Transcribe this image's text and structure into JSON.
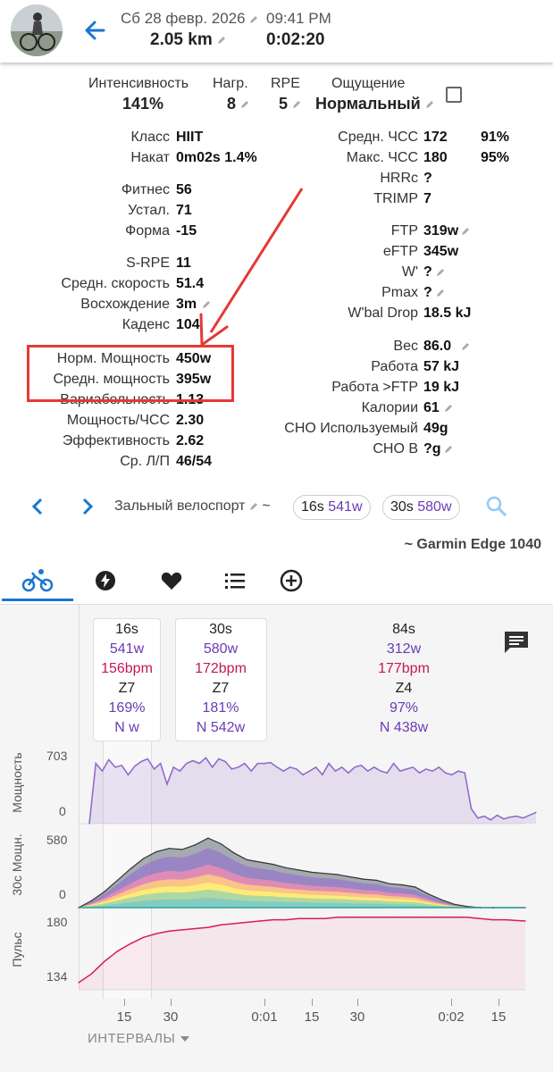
{
  "header": {
    "date": "Сб 28 февр. 2026",
    "time": "09:41 PM",
    "distance": "2.05 km",
    "duration": "0:02:20"
  },
  "summary": {
    "intensity_label": "Интенсивность",
    "intensity_value": "141%",
    "load_label": "Нагр.",
    "load_value": "8",
    "rpe_label": "RPE",
    "rpe_value": "5",
    "feel_label": "Ощущение",
    "feel_value": "Нормальный"
  },
  "left_stats": [
    {
      "label": "Класс",
      "value": "HIIT"
    },
    {
      "label": "Накат",
      "value": "0m02s 1.4%"
    },
    {
      "label": "Фитнес",
      "value": "56"
    },
    {
      "label": "Устал.",
      "value": "71"
    },
    {
      "label": "Форма",
      "value": "-15"
    },
    {
      "label": "S-RPE",
      "value": "11"
    },
    {
      "label": "Средн. скорость",
      "value": "51.4"
    },
    {
      "label": "Восхождение",
      "value": "3m"
    },
    {
      "label": "Каденс",
      "value": "104"
    },
    {
      "label": "Норм. Мощность",
      "value": "450w"
    },
    {
      "label": "Средн. мощность",
      "value": "395w"
    },
    {
      "label": "Вариабельность",
      "value": "1.13"
    },
    {
      "label": "Мощность/ЧСС",
      "value": "2.30"
    },
    {
      "label": "Эффективность",
      "value": "2.62"
    },
    {
      "label": "Ср. Л/П",
      "value": "46/54"
    }
  ],
  "right_stats": [
    {
      "label": "Средн. ЧСС",
      "value": "172",
      "extra": "91%"
    },
    {
      "label": "Макс. ЧСС",
      "value": "180",
      "extra": "95%"
    },
    {
      "label": "HRRc",
      "value": "?"
    },
    {
      "label": "TRIMP",
      "value": "7"
    },
    {
      "label": "FTP",
      "value": "319w"
    },
    {
      "label": "eFTP",
      "value": "345w"
    },
    {
      "label": "W'",
      "value": "?"
    },
    {
      "label": "Pmax",
      "value": "?"
    },
    {
      "label": "W'bal Drop",
      "value": "18.5 kJ"
    },
    {
      "label": "Вес",
      "value": "86.0"
    },
    {
      "label": "Работа",
      "value": "57 kJ"
    },
    {
      "label": "Работа >FTP",
      "value": "19 kJ"
    },
    {
      "label": "Калории",
      "value": "61"
    },
    {
      "label": "CHO Используемый",
      "value": "49g"
    },
    {
      "label": "CHO В",
      "value": "?g"
    }
  ],
  "activity": {
    "type": "Зальный велоспорт",
    "tilde": "~",
    "pill1_dur": "16s",
    "pill1_power": "541w",
    "pill2_dur": "30s",
    "pill2_power": "580w",
    "device": "~ Garmin Edge 1040"
  },
  "intervals": [
    {
      "dur": "16s",
      "power": "541w",
      "hr": "156bpm",
      "zone": "Z7",
      "pct": "169%",
      "np": "N w"
    },
    {
      "dur": "30s",
      "power": "580w",
      "hr": "172bpm",
      "zone": "Z7",
      "pct": "181%",
      "np": "N 542w"
    },
    {
      "dur": "84s",
      "power": "312w",
      "hr": "177bpm",
      "zone": "Z4",
      "pct": "97%",
      "np": "N 438w"
    }
  ],
  "chart_data": [
    {
      "type": "line",
      "ylabel": "Мощность",
      "y_ticks": [
        "703",
        "0"
      ],
      "x": [
        0,
        2,
        4,
        6,
        8,
        10,
        12,
        14,
        16,
        18,
        20,
        22,
        24,
        26,
        28,
        30,
        32,
        34,
        36,
        38,
        40,
        42,
        44,
        46,
        48,
        50,
        52,
        54,
        56,
        58,
        60,
        62,
        64,
        66,
        68,
        70,
        72,
        74,
        76,
        78,
        80,
        82,
        84,
        86,
        88,
        90,
        92,
        94,
        96,
        98,
        100,
        102,
        104,
        106,
        108,
        110,
        112,
        114,
        116,
        118,
        120,
        122,
        124,
        126,
        128,
        130,
        132,
        134,
        136,
        138
      ],
      "values": [
        0,
        640,
        560,
        680,
        600,
        620,
        520,
        610,
        660,
        690,
        580,
        640,
        420,
        600,
        560,
        640,
        670,
        640,
        700,
        600,
        690,
        660,
        580,
        600,
        640,
        560,
        640,
        640,
        650,
        600,
        560,
        600,
        580,
        520,
        560,
        600,
        520,
        640,
        560,
        600,
        540,
        600,
        620,
        560,
        600,
        560,
        540,
        640,
        560,
        580,
        600,
        540,
        580,
        560,
        600,
        540,
        520,
        560,
        540,
        160,
        60,
        80,
        40,
        90,
        50,
        70,
        80,
        60,
        90,
        120
      ]
    },
    {
      "type": "area",
      "ylabel": "30с Мощн.",
      "y_ticks": [
        "580",
        "0"
      ],
      "x": [
        0,
        4,
        8,
        12,
        16,
        20,
        24,
        28,
        32,
        36,
        40,
        44,
        48,
        52,
        56,
        60,
        64,
        68,
        72,
        76,
        80,
        84,
        88,
        92,
        96,
        100,
        104,
        108,
        112,
        116,
        120,
        124,
        128,
        138
      ],
      "values": [
        0,
        60,
        140,
        240,
        340,
        430,
        490,
        520,
        510,
        550,
        610,
        560,
        480,
        420,
        400,
        380,
        350,
        330,
        310,
        300,
        290,
        270,
        250,
        240,
        210,
        200,
        180,
        120,
        70,
        30,
        10,
        0,
        0,
        0
      ]
    },
    {
      "type": "line",
      "ylabel": "Пульс",
      "y_ticks": [
        "180",
        "134"
      ],
      "x": [
        0,
        4,
        8,
        12,
        16,
        20,
        24,
        28,
        32,
        36,
        40,
        44,
        48,
        52,
        56,
        60,
        64,
        68,
        72,
        76,
        80,
        84,
        88,
        92,
        96,
        100,
        104,
        108,
        112,
        116,
        120,
        124,
        128,
        132,
        138
      ],
      "values": [
        128,
        135,
        145,
        153,
        159,
        164,
        167,
        169,
        170,
        171,
        172,
        174,
        175,
        176,
        177,
        178,
        178,
        179,
        179,
        179,
        180,
        180,
        180,
        180,
        180,
        180,
        180,
        180,
        180,
        180,
        180,
        179,
        178,
        178,
        177
      ]
    }
  ],
  "x_ticks": [
    "15",
    "30",
    "0:01",
    "15",
    "30",
    "0:02",
    "15"
  ],
  "intervals_button": "ИНТЕРВАЛЫ",
  "colors": {
    "accent": "#1976d2",
    "purple": "#6a3bb5",
    "hr": "#c2185b",
    "annotation": "#e53935"
  }
}
